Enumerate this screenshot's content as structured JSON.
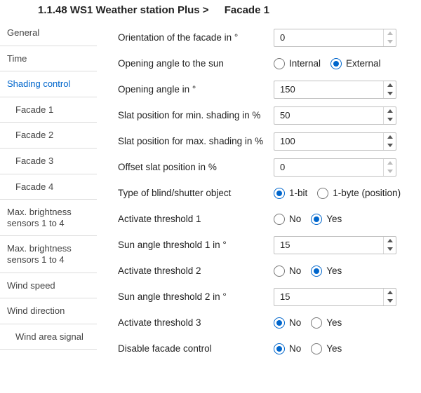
{
  "header": {
    "breadcrumb": "1.1.48 WS1 Weather station Plus >",
    "current": "Facade 1"
  },
  "sidebar": {
    "items": [
      {
        "label": "General",
        "active": false,
        "sub": false
      },
      {
        "label": "Time",
        "active": false,
        "sub": false
      },
      {
        "label": "Shading control",
        "active": true,
        "sub": false
      },
      {
        "label": "Facade 1",
        "active": false,
        "sub": true
      },
      {
        "label": "Facade 2",
        "active": false,
        "sub": true
      },
      {
        "label": "Facade 3",
        "active": false,
        "sub": true
      },
      {
        "label": "Facade 4",
        "active": false,
        "sub": true
      },
      {
        "label": "Max. brightness sensors 1 to 4",
        "active": false,
        "sub": false
      },
      {
        "label": "Max. brightness sensors 1 to 4",
        "active": false,
        "sub": false
      },
      {
        "label": "Wind speed",
        "active": false,
        "sub": false
      },
      {
        "label": "Wind direction",
        "active": false,
        "sub": false
      },
      {
        "label": "Wind area signal",
        "active": false,
        "sub": true
      }
    ]
  },
  "fields": {
    "orientation": {
      "label": "Orientation of the facade in °",
      "type": "spinner",
      "value": "0",
      "disabled": true
    },
    "openAngleSun": {
      "label": "Opening angle to the sun",
      "type": "radio",
      "options": [
        "Internal",
        "External"
      ],
      "selected": 1
    },
    "openAngle": {
      "label": "Opening angle in °",
      "type": "spinner",
      "value": "150",
      "disabled": false
    },
    "slatMin": {
      "label": "Slat position for min. shading in %",
      "type": "spinner",
      "value": "50",
      "disabled": false
    },
    "slatMax": {
      "label": "Slat position for max. shading in %",
      "type": "spinner",
      "value": "100",
      "disabled": false
    },
    "offsetSlat": {
      "label": "Offset slat position in %",
      "type": "spinner",
      "value": "0",
      "disabled": true
    },
    "blindType": {
      "label": "Type of blind/shutter object",
      "type": "radio",
      "options": [
        "1-bit",
        "1-byte (position)"
      ],
      "selected": 0
    },
    "actThr1": {
      "label": "Activate threshold 1",
      "type": "radio",
      "options": [
        "No",
        "Yes"
      ],
      "selected": 1
    },
    "sunThr1": {
      "label": "Sun angle threshold 1 in °",
      "type": "spinner",
      "value": "15",
      "disabled": false
    },
    "actThr2": {
      "label": "Activate threshold 2",
      "type": "radio",
      "options": [
        "No",
        "Yes"
      ],
      "selected": 1
    },
    "sunThr2": {
      "label": "Sun angle threshold 2 in °",
      "type": "spinner",
      "value": "15",
      "disabled": false
    },
    "actThr3": {
      "label": "Activate threshold 3",
      "type": "radio",
      "options": [
        "No",
        "Yes"
      ],
      "selected": 0
    },
    "disableFacade": {
      "label": "Disable facade control",
      "type": "radio",
      "options": [
        "No",
        "Yes"
      ],
      "selected": 0
    }
  },
  "fieldOrder": [
    "orientation",
    "openAngleSun",
    "openAngle",
    "slatMin",
    "slatMax",
    "offsetSlat",
    "blindType",
    "actThr1",
    "sunThr1",
    "actThr2",
    "sunThr2",
    "actThr3",
    "disableFacade"
  ]
}
